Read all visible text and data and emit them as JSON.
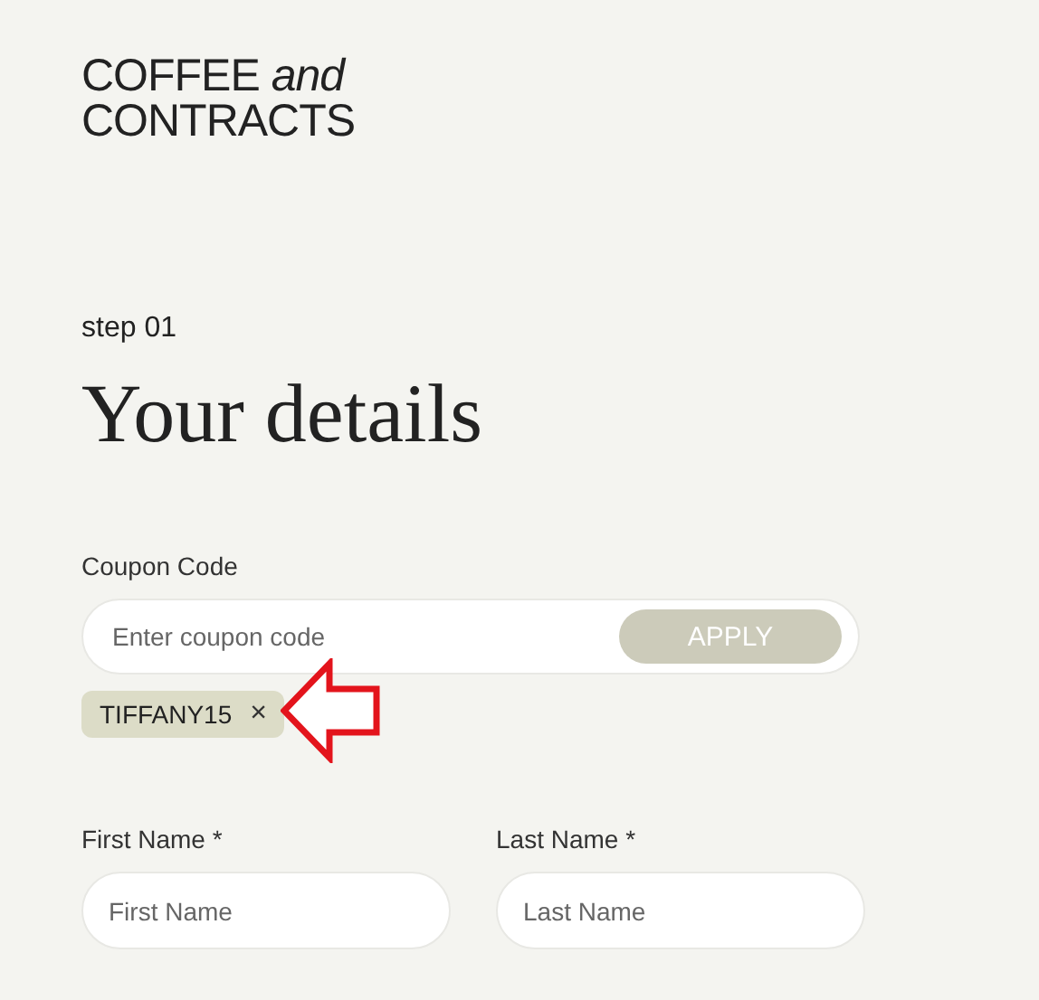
{
  "logo": {
    "line_1": "COFFEE *and*",
    "line_2": "CONTRACTS"
  },
  "step": "step 01",
  "heading": "Your details",
  "coupon": {
    "label": "Coupon Code",
    "placeholder": "Enter coupon code",
    "button": "APPLY",
    "applied_codes": [
      {
        "code": "TIFFANY15",
        "remove": "×"
      }
    ]
  },
  "fields": [
    {
      "label": "First Name *",
      "placeholder": "First Name"
    },
    {
      "label": "Last Name *",
      "placeholder": "Last Name"
    }
  ]
}
